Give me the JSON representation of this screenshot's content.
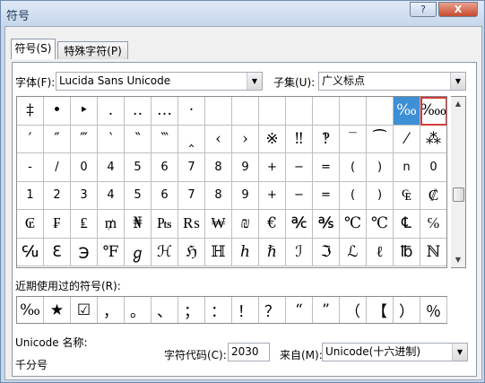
{
  "window": {
    "title": "符号",
    "help_label": "?",
    "close_label": "X"
  },
  "tabs": [
    {
      "label": "符号(S)"
    },
    {
      "label": "特殊字符(P)"
    }
  ],
  "font": {
    "label": "字体(F):",
    "value": "Lucida Sans Unicode"
  },
  "subset": {
    "label": "子集(U):",
    "value": "广义标点"
  },
  "symbols": [
    "‡",
    "•",
    "‣",
    "․",
    "‥",
    "…",
    "‧",
    "",
    "",
    "",
    "",
    "",
    "",
    "",
    "‰",
    "‱",
    "′",
    "″",
    "‴",
    "‵",
    "‶",
    "‷",
    "‸",
    "‹",
    "›",
    "※",
    "‼",
    "‽",
    "‾",
    "⁀",
    "⁄",
    "⁂",
    "-",
    "/",
    "0",
    "4",
    "5",
    "6",
    "7",
    "8",
    "9",
    "+",
    "−",
    "=",
    "(",
    ")",
    "n",
    "0",
    "1",
    "2",
    "3",
    "4",
    "5",
    "6",
    "7",
    "8",
    "9",
    "+",
    "−",
    "=",
    "(",
    ")",
    "₠",
    "₡",
    "₢",
    "₣",
    "₤",
    "₥",
    "₦",
    "₧",
    "₨",
    "₩",
    "₪",
    "€",
    "℀",
    "℁",
    "℃",
    "℃",
    "℄",
    "℅",
    "℆",
    "ℇ",
    "℈",
    "℉",
    "ℊ",
    "ℋ",
    "ℌ",
    "ℍ",
    "ℎ",
    "ℏ",
    "ℐ",
    "ℑ",
    "ℒ",
    "ℓ",
    "℔",
    "ℕ"
  ],
  "selected_symbol": "‰",
  "hovered_symbol": "‱",
  "recent": {
    "label": "近期使用过的符号(R):",
    "symbols": [
      "‰",
      "★",
      "☑",
      "，",
      "。",
      "、",
      "；",
      "：",
      "！",
      "？",
      "“",
      "”",
      "（",
      "【",
      "）",
      "％"
    ]
  },
  "char_name": {
    "label": "Unicode 名称:",
    "value": "千分号"
  },
  "char_code": {
    "label": "字符代码(C):",
    "value": "2030"
  },
  "from": {
    "label": "来自(M):",
    "value": "Unicode(十六进制)"
  },
  "colors": {
    "selection": "#3d8fd6",
    "hover_border": "#d43a3a",
    "close": "#c74a2e"
  }
}
